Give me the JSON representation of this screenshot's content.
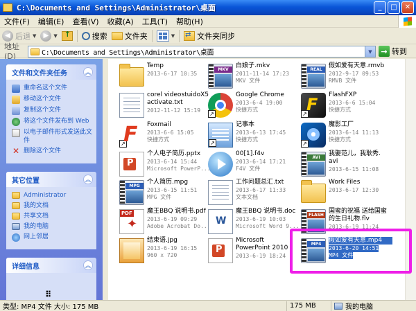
{
  "title_bar": {
    "title": "C:\\Documents and Settings\\Administrator\\桌面",
    "minimize": "_",
    "maximize": "□",
    "close": "✕"
  },
  "menu": {
    "items": [
      "文件(F)",
      "编辑(E)",
      "查看(V)",
      "收藏(A)",
      "工具(T)",
      "帮助(H)"
    ]
  },
  "toolbar": {
    "back_label": "后退",
    "search_label": "搜索",
    "folders_label": "文件夹",
    "sync_label": "文件夹同步"
  },
  "address": {
    "label": "地址(D)",
    "path": "C:\\Documents and Settings\\Administrator\\桌面",
    "go_label": "转到"
  },
  "left_pane": {
    "tasks_title": "文件和文件夹任务",
    "tasks": [
      {
        "label": "重命名这个文件",
        "icon": "rename-icon"
      },
      {
        "label": "移动这个文件",
        "icon": "move-icon"
      },
      {
        "label": "复制这个文件",
        "icon": "copy-icon"
      },
      {
        "label": "将这个文件发布到 Web",
        "icon": "web-publish-icon"
      },
      {
        "label": "以电子邮件形式发送此文件",
        "icon": "email-icon"
      },
      {
        "label": "删除这个文件",
        "icon": "delete-icon"
      }
    ],
    "places_title": "其它位置",
    "places": [
      {
        "label": "Administrator",
        "icon": "folder-icon"
      },
      {
        "label": "我的文档",
        "icon": "folder-icon"
      },
      {
        "label": "共享文档",
        "icon": "folder-icon"
      },
      {
        "label": "我的电脑",
        "icon": "computer-icon"
      },
      {
        "label": "网上邻居",
        "icon": "network-icon"
      }
    ],
    "details_title": "详细信息"
  },
  "files": [
    {
      "name": "Temp",
      "meta": [
        "2013-6-17 10:35"
      ],
      "icon": "folder",
      "shortcut": false
    },
    {
      "name": "白娘子.mkv",
      "meta": [
        "2011-11-14 17:23",
        "MKV 文件"
      ],
      "icon": "video",
      "tag": "MKV",
      "tag_color": "#7a2a8a",
      "shortcut": false
    },
    {
      "name": "假如爱有天意.rmvb",
      "meta": [
        "2012-9-17 09:53",
        "RMVB 文件"
      ],
      "icon": "video",
      "tag": "REAL",
      "tag_color": "#2b5db7",
      "shortcut": false
    },
    {
      "name": "corel videostuidoX5\nactivate.txt",
      "meta": [
        "2012-11-12 15:19"
      ],
      "icon": "text",
      "shortcut": false
    },
    {
      "name": "Google Chrome",
      "meta": [
        "2013-6-4 19:00",
        "快捷方式"
      ],
      "icon": "chrome",
      "shortcut": true
    },
    {
      "name": "FlashFXP",
      "meta": [
        "2013-6-6 15:04",
        "快捷方式"
      ],
      "icon": "flashfxp",
      "shortcut": true
    },
    {
      "name": "Foxmail",
      "meta": [
        "2013-6-6 15:05",
        "快捷方式"
      ],
      "icon": "foxmail",
      "shortcut": true
    },
    {
      "name": "记事本",
      "meta": [
        "2013-6-13 17:45",
        "快捷方式"
      ],
      "icon": "notepad",
      "shortcut": true
    },
    {
      "name": "魔影工厂",
      "meta": [
        "2013-6-14 11:13",
        "快捷方式"
      ],
      "icon": "film",
      "shortcut": true
    },
    {
      "name": "个人电子简历.pptx",
      "meta": [
        "2013-6-14 15:44",
        "Microsoft PowerP..."
      ],
      "icon": "ppt",
      "shortcut": false
    },
    {
      "name": "00[1].f4v",
      "meta": [
        "2013-6-14 17:21",
        "F4V 文件"
      ],
      "icon": "player",
      "shortcut": false
    },
    {
      "name": "我娶范儿，我耿秀.\navi",
      "meta": [
        "2013-6-15 11:08"
      ],
      "icon": "video",
      "tag": "AVI",
      "tag_color": "#3a7a3a",
      "shortcut": false
    },
    {
      "name": "个人简历.mpg",
      "meta": [
        "2013-6-15 11:51",
        "MPG 文件"
      ],
      "icon": "video",
      "tag": "MPG",
      "tag_color": "#2b5db7",
      "shortcut": false
    },
    {
      "name": "工作问题总汇.txt",
      "meta": [
        "2013-6-17 11:33",
        "文本文档"
      ],
      "icon": "text",
      "shortcut": false
    },
    {
      "name": "Work Files",
      "meta": [
        "2013-6-17 12:30"
      ],
      "icon": "folder",
      "shortcut": false
    },
    {
      "name": "魔王BBQ 说明书.pdf",
      "meta": [
        "2013-6-19 09:29",
        "Adobe Acrobat Do..."
      ],
      "icon": "pdf",
      "shortcut": false
    },
    {
      "name": "魔王BBQ 说明书.doc",
      "meta": [
        "2013-6-19 10:03",
        "Microsoft Word 9..."
      ],
      "icon": "doc",
      "shortcut": false
    },
    {
      "name": "国蜜的祝福 送给国蜜\n的生日礼物.flv",
      "meta": [
        "2013-6-19 11:24"
      ],
      "icon": "video",
      "tag": "FLASH",
      "tag_color": "#b33a1a",
      "shortcut": false
    },
    {
      "name": "结束语.jpg",
      "meta": [
        "2013-6-19 16:15",
        "960 x 720"
      ],
      "icon": "jpg",
      "shortcut": false
    },
    {
      "name": "Microsoft\nPowerPoint 2010",
      "meta": [
        "2013-6-19 18:24"
      ],
      "icon": "ppt",
      "shortcut": false
    },
    {
      "name": "假如爱有天意.mp4",
      "meta": [
        "2013-6-20 14:51",
        "MP4 文件"
      ],
      "icon": "video",
      "tag": "MP4",
      "tag_color": "#2b5db7",
      "shortcut": false,
      "selected": true
    }
  ],
  "status": {
    "left": "类型: MP4 文件 大小: 175 MB",
    "size": "175 MB",
    "location": "我的电脑"
  },
  "colors": {
    "selection": "#316ac5",
    "highlight_box": "#ee1fe8",
    "left_pane": "#7ba2e7"
  }
}
